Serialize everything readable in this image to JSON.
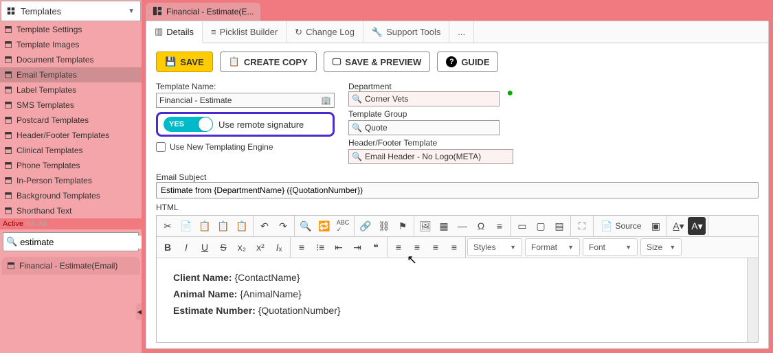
{
  "sidebar": {
    "header": "Templates",
    "items": [
      {
        "label": "Template Settings"
      },
      {
        "label": "Template Images"
      },
      {
        "label": "Document Templates"
      },
      {
        "label": "Email Templates",
        "active": true
      },
      {
        "label": "Label Templates"
      },
      {
        "label": "SMS Templates"
      },
      {
        "label": "Postcard Templates"
      },
      {
        "label": "Header/Footer Templates"
      },
      {
        "label": "Clinical Templates"
      },
      {
        "label": "Phone Templates"
      },
      {
        "label": "In-Person Templates"
      },
      {
        "label": "Background Templates"
      },
      {
        "label": "Shorthand Text"
      }
    ],
    "filters": {
      "active": "Active",
      "ia": "I/A",
      "all": "All"
    },
    "search_value": "estimate",
    "result": "Financial - Estimate(Email)"
  },
  "tab_title": "Financial - Estimate(E...",
  "subtabs": [
    {
      "label": "Details",
      "active": true
    },
    {
      "label": "Picklist Builder"
    },
    {
      "label": "Change Log"
    },
    {
      "label": "Support Tools"
    },
    {
      "label": "..."
    }
  ],
  "buttons": {
    "save": "SAVE",
    "copy": "CREATE COPY",
    "preview": "SAVE & PREVIEW",
    "guide": "GUIDE"
  },
  "form": {
    "template_name_label": "Template Name:",
    "template_name_value": "Financial - Estimate",
    "toggle_yes": "YES",
    "toggle_label": "Use remote signature",
    "new_engine": "Use New Templating Engine",
    "department_label": "Department",
    "department_value": "Corner Vets",
    "group_label": "Template Group",
    "group_value": "Quote",
    "hf_label": "Header/Footer Template",
    "hf_value": "Email Header - No Logo(META)"
  },
  "subject": {
    "label": "Email Subject",
    "value": "Estimate from {DepartmentName} ({QuotationNumber})"
  },
  "html_label": "HTML",
  "editor_dropdowns": {
    "styles": "Styles",
    "format": "Format",
    "font": "Font",
    "size": "Size",
    "source": "Source"
  },
  "body": {
    "l1a": "Client Name: ",
    "l1b": "{ContactName}",
    "l2a": "Animal Name: ",
    "l2b": "{AnimalName}",
    "l3a": "Estimate Number: ",
    "l3b": "{QuotationNumber}"
  }
}
